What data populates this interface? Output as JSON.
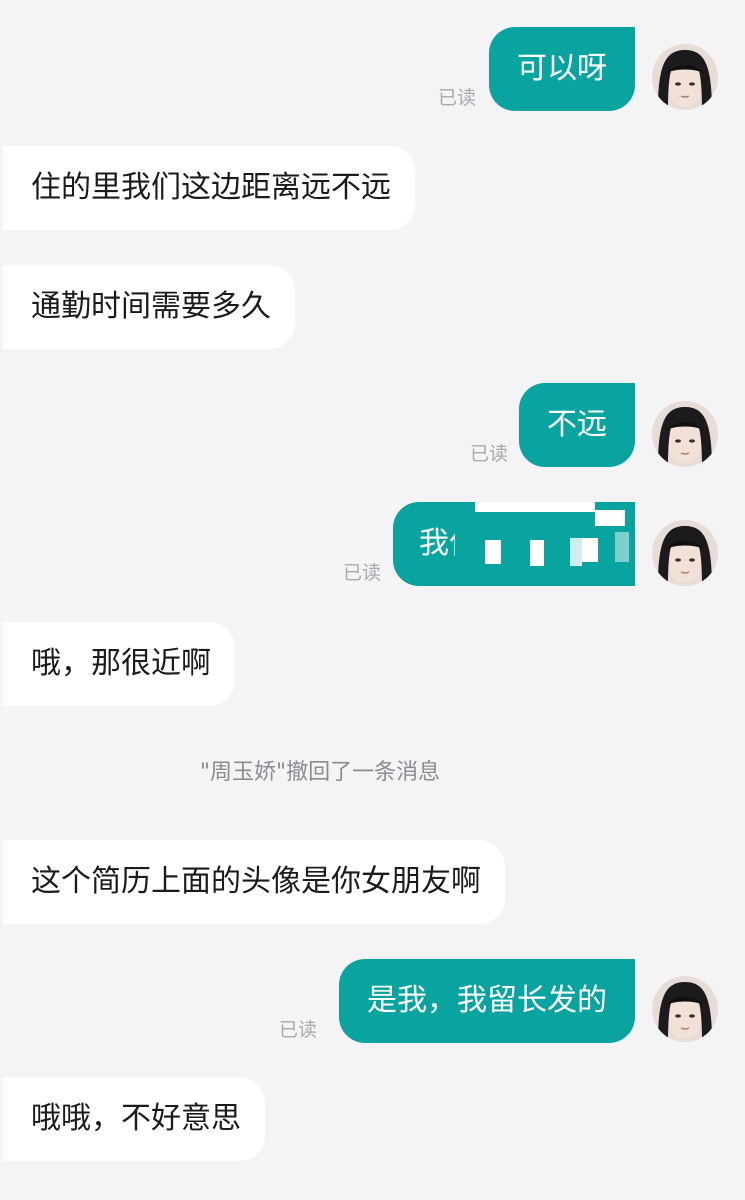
{
  "colors": {
    "background": "#f4f4f6",
    "incoming_bubble": "#ffffff",
    "outgoing_bubble": "#0aa4a0",
    "read_text": "#a9a9ae"
  },
  "messages": [
    {
      "id": 1,
      "direction": "out",
      "text": "可以呀",
      "read": "已读",
      "avatar": "user-avatar"
    },
    {
      "id": 2,
      "direction": "in",
      "text": "住的里我们这边距离远不远"
    },
    {
      "id": 3,
      "direction": "in",
      "text": "通勤时间需要多久"
    },
    {
      "id": 4,
      "direction": "out",
      "text": "不远",
      "read": "已读",
      "avatar": "user-avatar"
    },
    {
      "id": 5,
      "direction": "out",
      "text": "我住",
      "read": "已读",
      "avatar": "user-avatar",
      "redacted": true
    },
    {
      "id": 6,
      "direction": "in",
      "text": "哦，那很近啊"
    },
    {
      "id": 7,
      "direction": "system",
      "text": "\"周玉娇\"撤回了一条消息"
    },
    {
      "id": 8,
      "direction": "in",
      "text": "这个简历上面的头像是你女朋友啊"
    },
    {
      "id": 9,
      "direction": "out",
      "text": "是我，我留长发的",
      "read": "已读",
      "avatar": "user-avatar"
    },
    {
      "id": 10,
      "direction": "in",
      "text": "哦哦，不好意思"
    }
  ]
}
